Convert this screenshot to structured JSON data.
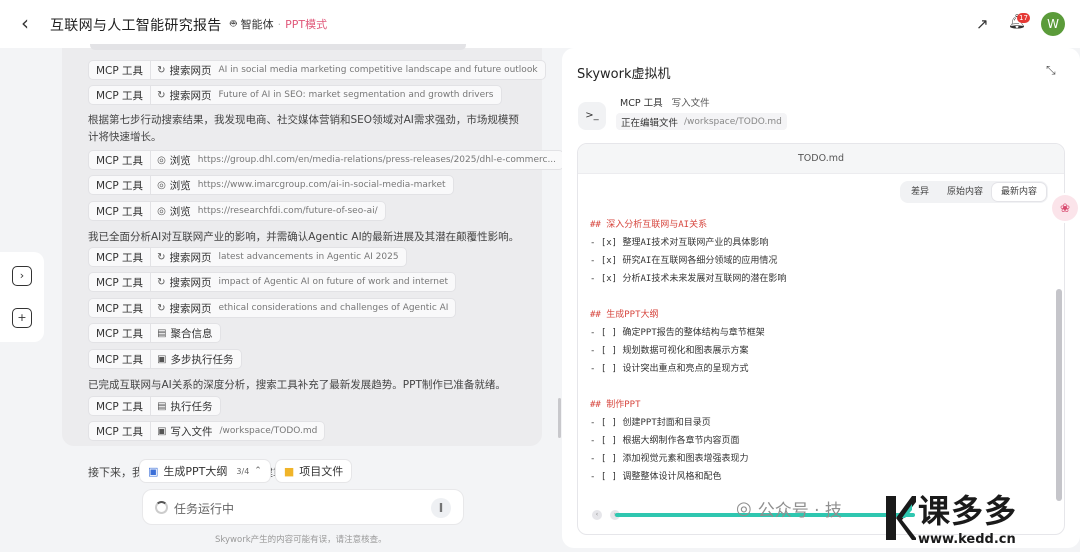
{
  "header": {
    "back_icon": "arrow-left-icon",
    "title": "互联网与人工智能研究报告",
    "agent_label": "智能体",
    "separator": "·",
    "mode_label": "PPT模式",
    "notification_count": "17",
    "avatar_initial": "W"
  },
  "chat": {
    "items": [
      {
        "kind": "tool",
        "tool": "MCP 工具",
        "icon": "search-icon",
        "action": "搜索网页",
        "arg": "AI in social media marketing competitive landscape and future outlook"
      },
      {
        "kind": "tool",
        "tool": "MCP 工具",
        "icon": "search-icon",
        "action": "搜索网页",
        "arg": "Future of AI in SEO: market segmentation and growth drivers"
      },
      {
        "kind": "text",
        "text": "根据第七步行动搜索结果，我发现电商、社交媒体营销和SEO领域对AI需求强劲，市场规模预计将快速增长。"
      },
      {
        "kind": "tool",
        "tool": "MCP 工具",
        "icon": "compass-icon",
        "action": "浏览",
        "arg": "https://group.dhl.com/en/media-relations/press-releases/2025/dhl-e-commerc..."
      },
      {
        "kind": "tool",
        "tool": "MCP 工具",
        "icon": "compass-icon",
        "action": "浏览",
        "arg": "https://www.imarcgroup.com/ai-in-social-media-market"
      },
      {
        "kind": "tool",
        "tool": "MCP 工具",
        "icon": "compass-icon",
        "action": "浏览",
        "arg": "https://researchfdi.com/future-of-seo-ai/"
      },
      {
        "kind": "text",
        "text": "我已全面分析AI对互联网产业的影响，并需确认Agentic AI的最新进展及其潜在颠覆性影响。"
      },
      {
        "kind": "tool",
        "tool": "MCP 工具",
        "icon": "search-icon",
        "action": "搜索网页",
        "arg": "latest advancements in Agentic AI 2025"
      },
      {
        "kind": "tool",
        "tool": "MCP 工具",
        "icon": "search-icon",
        "action": "搜索网页",
        "arg": "impact of Agentic AI on future of work and internet"
      },
      {
        "kind": "tool",
        "tool": "MCP 工具",
        "icon": "search-icon",
        "action": "搜索网页",
        "arg": "ethical considerations and challenges of Agentic AI"
      },
      {
        "kind": "tool",
        "tool": "MCP 工具",
        "icon": "aggregate-icon",
        "action": "聚合信息",
        "arg": ""
      },
      {
        "kind": "tool",
        "tool": "MCP 工具",
        "icon": "terminal-icon",
        "action": "多步执行任务",
        "arg": ""
      },
      {
        "kind": "text",
        "text": "已完成互联网与AI关系的深度分析，搜索工具补充了最新发展趋势。PPT制作已准备就绪。"
      },
      {
        "kind": "tool",
        "tool": "MCP 工具",
        "icon": "document-icon",
        "action": "执行任务",
        "arg": ""
      },
      {
        "kind": "tool",
        "tool": "MCP 工具",
        "icon": "terminal-icon",
        "action": "写入文件",
        "arg": "/workspace/TODO.md"
      }
    ],
    "tail_text": "接下来，我将进入PPT制作环节，创建章节框架"
  },
  "chips": {
    "ppt_outline_label": "生成PPT大纲",
    "ppt_outline_count": "3/4",
    "project_files_label": "项目文件"
  },
  "task": {
    "status": "任务运行中",
    "disclaimer": "Skywork产生的内容可能有误，请注意核查。"
  },
  "vm": {
    "title": "Skywork虚拟机",
    "tool_label": "MCP 工具",
    "tool_action": "写入文件",
    "editing_label": "正在编辑文件",
    "editing_path": "/workspace/TODO.md",
    "doc_name": "TODO.md",
    "tabs": [
      "差异",
      "原始内容",
      "最新内容"
    ],
    "active_tab": "最新内容",
    "lines": [
      {
        "h": true,
        "text": "## 深入分析互联网与AI关系"
      },
      {
        "h": false,
        "text": "- [x] 整理AI技术对互联网产业的具体影响"
      },
      {
        "h": false,
        "text": "- [x] 研究AI在互联网各细分领域的应用情况"
      },
      {
        "h": false,
        "text": "- [x] 分析AI技术未来发展对互联网的潜在影响"
      },
      {
        "h": false,
        "text": ""
      },
      {
        "h": true,
        "text": "## 生成PPT大纲"
      },
      {
        "h": false,
        "text": "- [ ] 确定PPT报告的整体结构与章节框架"
      },
      {
        "h": false,
        "text": "- [ ] 规划数据可视化和图表展示方案"
      },
      {
        "h": false,
        "text": "- [ ] 设计突出重点和亮点的呈现方式"
      },
      {
        "h": false,
        "text": ""
      },
      {
        "h": true,
        "text": "## 制作PPT"
      },
      {
        "h": false,
        "text": "- [ ] 创建PPT封面和目录页"
      },
      {
        "h": false,
        "text": "- [ ] 根据大纲制作各章节内容页面"
      },
      {
        "h": false,
        "text": "- [ ] 添加视觉元素和图表增强表现力"
      },
      {
        "h": false,
        "text": "- [ ] 调整整体设计风格和配色"
      }
    ]
  },
  "watermark": {
    "wechat_text": "公众号 · 技",
    "brand": "课多多",
    "url": "www.kedd.cn"
  },
  "colors": {
    "accent_pink": "#e0587a",
    "heading_red": "#d6453d",
    "teal": "#2fc7b0"
  }
}
